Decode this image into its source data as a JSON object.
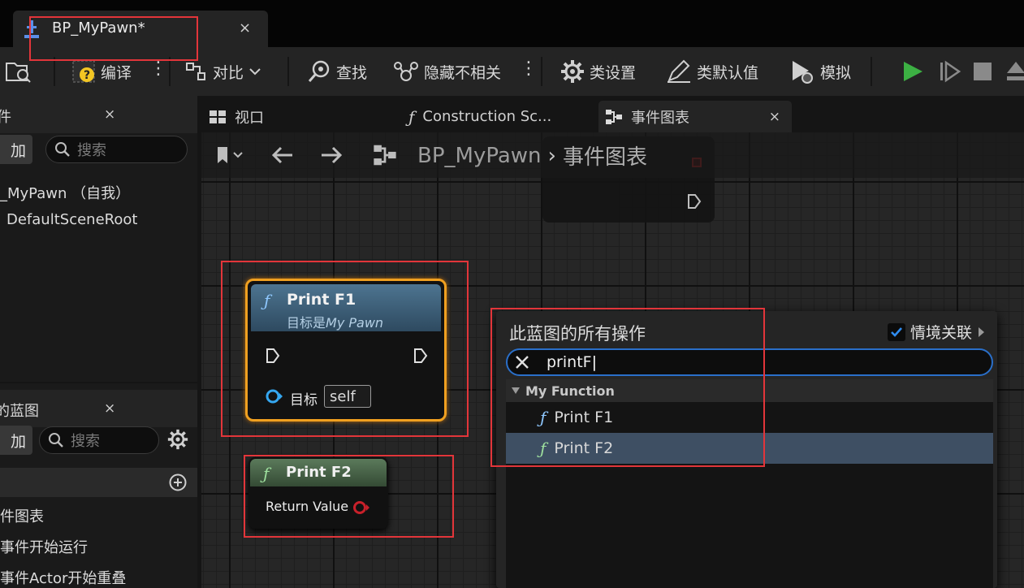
{
  "document_tab": {
    "title": "BP_MyPawn",
    "modified_marker": "*",
    "close": "×"
  },
  "toolbar": {
    "compile": "编译",
    "diff": "对比",
    "find": "查找",
    "hide_unrelated": "隐藏不相关",
    "class_settings": "类设置",
    "class_defaults": "类默认值",
    "simulate": "模拟"
  },
  "components_panel": {
    "title_fragment": "件",
    "add_label": "加",
    "search_placeholder": "搜索",
    "close": "×",
    "tree": [
      "_MyPawn （自我）",
      "DefaultSceneRoot"
    ]
  },
  "my_blueprint_panel": {
    "title_fragment": "的蓝图",
    "add_label": "加",
    "search_placeholder": "搜索",
    "close": "×",
    "items": [
      "件图表",
      "事件开始运行",
      "事件Actor开始重叠"
    ]
  },
  "editor_tabs": [
    {
      "label": "视口"
    },
    {
      "label": "Construction Sc..."
    },
    {
      "label": "事件图表",
      "close": "×"
    }
  ],
  "breadcrumb": {
    "root": "BP_MyPawn",
    "separator": "›",
    "current": "事件图表"
  },
  "nodes": {
    "print_f1": {
      "title": "Print F1",
      "subtitle_prefix": "目标是",
      "subtitle_target": "My Pawn",
      "target_label": "目标",
      "target_value": "self"
    },
    "print_f2": {
      "title": "Print F2",
      "output_label": "Return Value"
    }
  },
  "action_menu": {
    "title": "此蓝图的所有操作",
    "context_sensitive_label": "情境关联",
    "context_sensitive_checked": true,
    "search_value": "printF",
    "category": "My Function",
    "items": [
      {
        "label": "Print F1",
        "selected": false
      },
      {
        "label": "Print F2",
        "selected": true
      }
    ]
  },
  "colors": {
    "accent_blue": "#2a6fc9",
    "node_selected_outline": "#f0a020",
    "annotation_red": "#e2353a",
    "play_green": "#3cb043"
  }
}
